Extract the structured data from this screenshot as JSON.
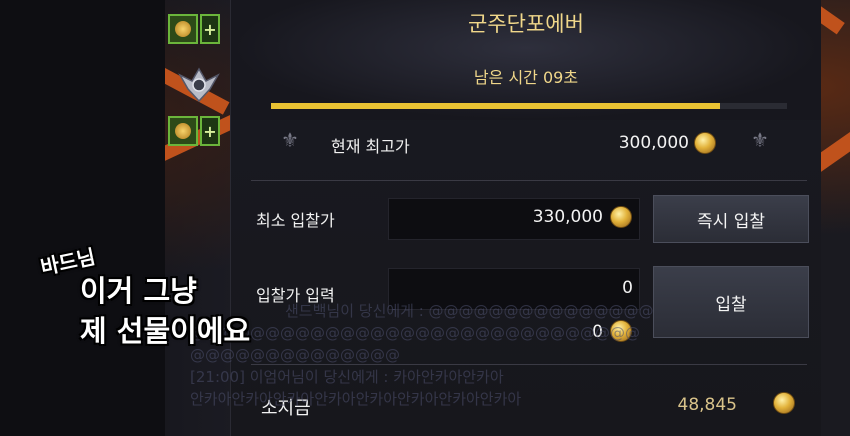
{
  "auction": {
    "title": "군주단포에버",
    "time_remaining": "남은 시간 09초",
    "timer_progress": 0.87,
    "current_highest": {
      "label": "현재 최고가",
      "value": "300,000"
    },
    "min_bid": {
      "label": "최소 입찰가",
      "value": "330,000"
    },
    "bid_input": {
      "label": "입찰가 입력",
      "value": "0",
      "total": "0"
    },
    "buttons": {
      "instant_bid": "즉시 입찰",
      "bid": "입찰"
    },
    "balance": {
      "label": "소지금",
      "value": "48,845"
    }
  },
  "chat_lines": [
    "샌드백님이 당신에게 : @@@@@@@@@@@@@@@",
    "@@@@@@@@@@@@@@@@@@@@@@@@@@@@@@",
    "@@@@@@@@@@@@@@",
    "[21:00] 이엄어님이 당신에게 : 카아안카아안카아",
    "안카아안카아안카아안카아안카아안카아안카아안카아"
  ],
  "captions": {
    "line1": "바드님",
    "line2": "이거 그냥",
    "line3": "제 선물이에요"
  },
  "colors": {
    "gold_text": "#f0d78a",
    "timer_bar": "#e9c233",
    "accent_orange": "#c0521c"
  }
}
